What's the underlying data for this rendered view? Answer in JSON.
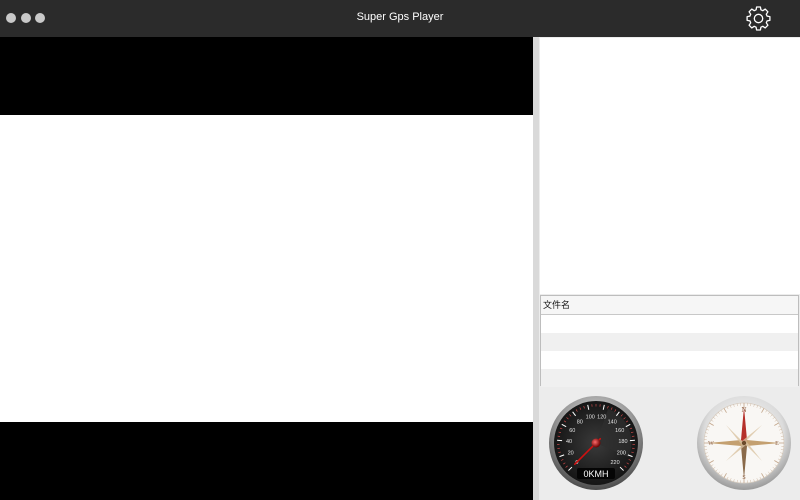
{
  "window": {
    "title": "Super Gps Player"
  },
  "filelist": {
    "column_header": "文件名",
    "rows": [
      "",
      "",
      "",
      ""
    ]
  },
  "speedometer": {
    "readout": "0KMH",
    "speed": 0,
    "max": 220,
    "ticks": [
      "0",
      "20",
      "40",
      "60",
      "80",
      "100",
      "120",
      "140",
      "160",
      "180",
      "200",
      "220"
    ]
  },
  "compass": {
    "labels": {
      "north": "N",
      "east": "E",
      "south": "S",
      "west": "W"
    },
    "heading": 0
  },
  "icons": {
    "settings": "gear-icon"
  }
}
